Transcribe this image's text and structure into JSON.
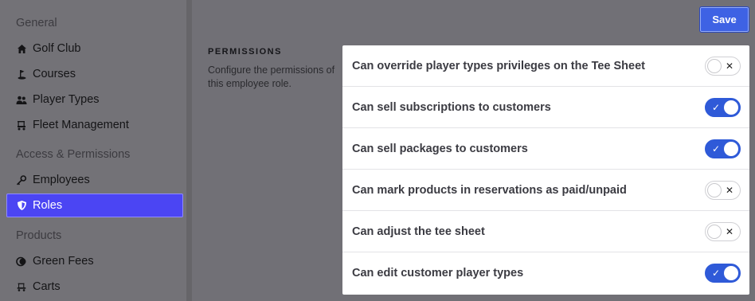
{
  "sidebar": {
    "sections": [
      {
        "title": "General"
      },
      {
        "title": "Access & Permissions"
      },
      {
        "title": "Products"
      }
    ],
    "items": [
      {
        "label": "Golf Club",
        "icon": "house-icon"
      },
      {
        "label": "Courses",
        "icon": "golf-flag-icon"
      },
      {
        "label": "Player Types",
        "icon": "users-icon"
      },
      {
        "label": "Fleet Management",
        "icon": "golf-cart-icon"
      },
      {
        "label": "Employees",
        "icon": "key-icon"
      },
      {
        "label": "Roles",
        "icon": "shield-icon",
        "active": true
      },
      {
        "label": "Green Fees",
        "icon": "coins-icon"
      },
      {
        "label": "Carts",
        "icon": "cart-icon"
      }
    ]
  },
  "toolbar": {
    "save_label": "Save"
  },
  "permissions": {
    "heading": "PERMISSIONS",
    "description": "Configure the permissions of this employee role.",
    "rows": [
      {
        "label": "Can override player types privileges on the Tee Sheet",
        "enabled": false
      },
      {
        "label": "Can sell subscriptions to customers",
        "enabled": true
      },
      {
        "label": "Can sell packages to customers",
        "enabled": true
      },
      {
        "label": "Can mark products in reservations as paid/unpaid",
        "enabled": false
      },
      {
        "label": "Can adjust the tee sheet",
        "enabled": false
      },
      {
        "label": "Can edit customer player types",
        "enabled": true
      }
    ]
  },
  "colors": {
    "accent": "#4b45f3",
    "toggle_on": "#2f5ad8",
    "save_button": "#3e62e4"
  }
}
